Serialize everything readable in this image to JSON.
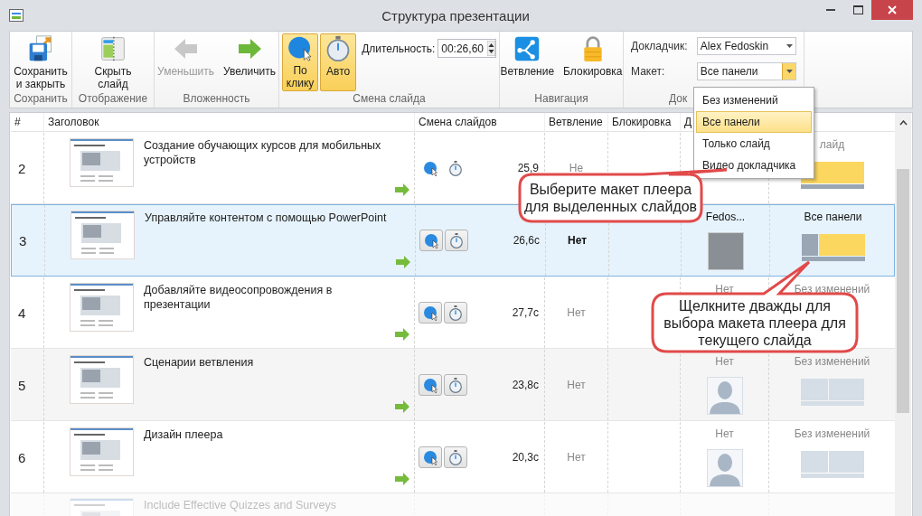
{
  "window": {
    "title": "Структура презентации"
  },
  "ribbon": {
    "groups": [
      {
        "label": "Сохранить",
        "buttons": [
          {
            "kind": "save",
            "label": "Сохранить и закрыть",
            "disabled": false
          }
        ]
      },
      {
        "label": "Отображение",
        "buttons": [
          {
            "kind": "hide_slide",
            "label": "Скрыть слайд",
            "disabled": false
          }
        ]
      },
      {
        "label": "Вложенность",
        "buttons": [
          {
            "kind": "arrow_left",
            "label": "Уменьшить",
            "disabled": true
          },
          {
            "kind": "arrow_right",
            "label": "Увеличить",
            "disabled": false
          }
        ]
      },
      {
        "label": "Смена слайда",
        "buttons": [
          {
            "kind": "click",
            "label": "По клику",
            "disabled": false,
            "selected": true
          },
          {
            "kind": "timer",
            "label": "Авто",
            "disabled": false,
            "selected": true
          }
        ],
        "duration": {
          "label": "Длительность:",
          "value": "00:26,60"
        }
      },
      {
        "label": "Навигация",
        "buttons": [
          {
            "kind": "branch",
            "label": "Ветвление",
            "disabled": false
          },
          {
            "kind": "lock",
            "label": "Блокировка",
            "disabled": false
          }
        ]
      },
      {
        "label": "Док",
        "fields": [
          {
            "label": "Докладчик:",
            "value": "Alex Fedoskin",
            "open": false
          },
          {
            "label": "Макет:",
            "value": "Все панели",
            "open": true
          }
        ]
      }
    ]
  },
  "layout_menu": {
    "items": [
      {
        "label": "Без изменений",
        "selected": false
      },
      {
        "label": "Все панели",
        "selected": true
      },
      {
        "label": "Только слайд",
        "selected": false
      },
      {
        "label": "Видео докладчика",
        "selected": false
      }
    ]
  },
  "table": {
    "columns": [
      "#",
      "Заголовок",
      "Смена слайдов",
      "Ветвление",
      "Блокировка",
      "Д"
    ],
    "rows": [
      {
        "number": "2",
        "title": "Создание обучающих курсов для мобильных устройств",
        "selected": false,
        "faded": false,
        "transition_framed": false,
        "time": "25,9",
        "branching": "Не",
        "layout_label": "лайд",
        "layout": {
          "kind": "slide_only"
        }
      },
      {
        "number": "3",
        "title": "Управляйте контентом с помощью PowerPoint",
        "selected": true,
        "faded": false,
        "transition_framed": true,
        "time": "26,6с",
        "branching": "Нет",
        "presenter": "Fedos...",
        "avatar": {
          "kind": "photo"
        },
        "layout_label": "Все панели",
        "layout": {
          "kind": "all_panels"
        }
      },
      {
        "number": "4",
        "title": "Добавляйте видеосопровождения в презентации",
        "selected": false,
        "faded": false,
        "transition_framed": true,
        "time": "27,7с",
        "branching": "Нет",
        "presenter": "Нет",
        "layout_label": "Без изменений"
      },
      {
        "number": "5",
        "title": "Сценарии ветвления",
        "selected": false,
        "faded": false,
        "transition_framed": true,
        "time": "23,8с",
        "branching": "Нет",
        "presenter": "Нет",
        "avatar": {
          "kind": "silhouette"
        },
        "layout_label": "Без изменений",
        "layout": {
          "kind": "unchanged"
        }
      },
      {
        "number": "6",
        "title": "Дизайн плеера",
        "selected": false,
        "faded": false,
        "transition_framed": true,
        "time": "20,3с",
        "branching": "Нет",
        "presenter": "Нет",
        "avatar": {
          "kind": "silhouette"
        },
        "layout_label": "Без изменений",
        "layout": {
          "kind": "unchanged"
        }
      },
      {
        "title": "Include Effective Quizzes and Surveys",
        "selected": false,
        "faded": true
      }
    ]
  },
  "callouts": [
    {
      "kind": "menu",
      "text": "Выберите макет плеера для выделенных слайдов"
    },
    {
      "kind": "cell",
      "text": "Щелкните дважды для выбора макета плеера для текущего слайда"
    }
  ]
}
